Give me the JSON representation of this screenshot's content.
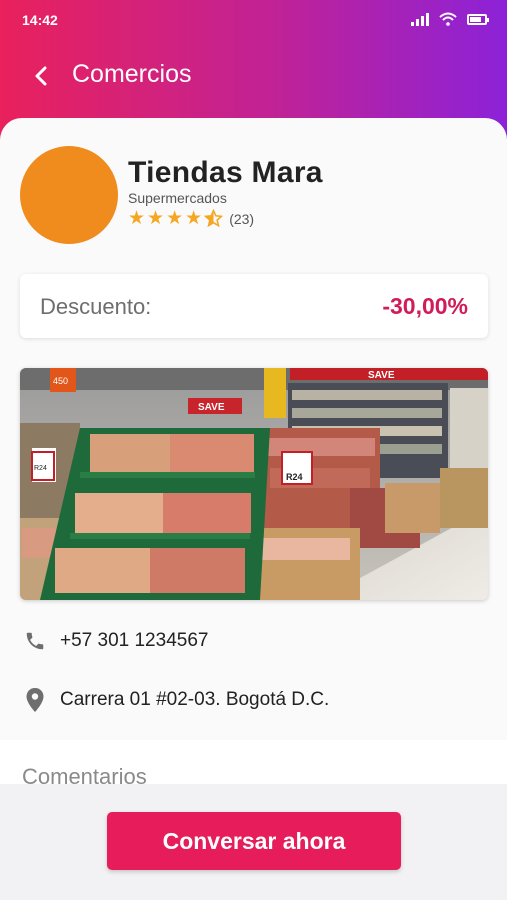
{
  "status_bar": {
    "time": "14:42"
  },
  "nav": {
    "title": "Comercios"
  },
  "store": {
    "name": "Tiendas Mara",
    "category": "Supermercados",
    "rating": 4.5,
    "review_count": "(23)",
    "avatar_color": "#f08b1d"
  },
  "discount": {
    "label": "Descuento:",
    "value": "-30,00%"
  },
  "photo": {
    "signs": {
      "save_top": "SAVE",
      "save_mid": "SAVE",
      "price_r24": "R24",
      "price_small": "R24",
      "top_sign": "450"
    }
  },
  "contact": {
    "phone": "+57 301 1234567",
    "address": "Carrera 01 #02-03. Bogotá D.C."
  },
  "comments": {
    "title": "Comentarios"
  },
  "action": {
    "chat_label": "Conversar ahora"
  },
  "colors": {
    "gradient_start": "#e9215c",
    "gradient_end": "#8c22d8",
    "accent": "#e61d5a",
    "discount_value": "#d11b5a",
    "star": "#f5a623"
  }
}
